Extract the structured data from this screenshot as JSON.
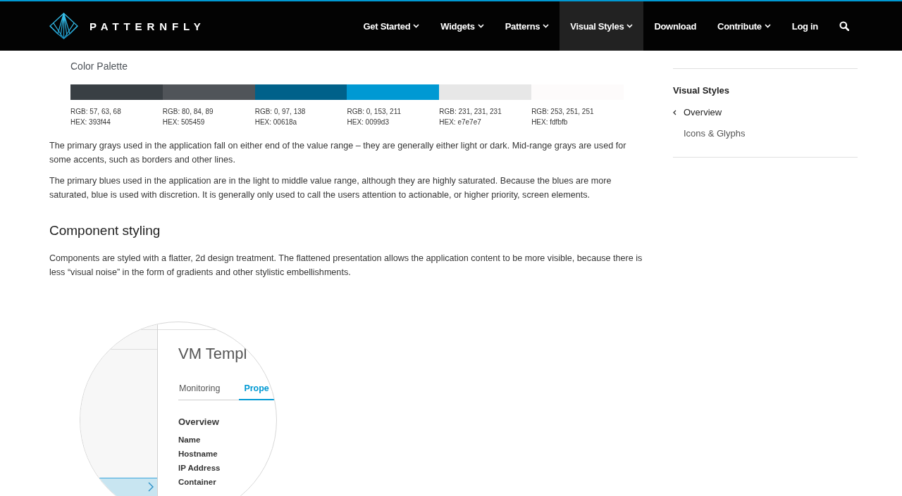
{
  "header": {
    "logo_text": "PATTERNFLY",
    "nav": [
      {
        "label": "Get Started",
        "has_dropdown": true,
        "selected": false
      },
      {
        "label": "Widgets",
        "has_dropdown": true,
        "selected": false
      },
      {
        "label": "Patterns",
        "has_dropdown": true,
        "selected": false
      },
      {
        "label": "Visual Styles",
        "has_dropdown": true,
        "selected": true
      },
      {
        "label": "Download",
        "has_dropdown": false,
        "selected": false
      },
      {
        "label": "Contribute",
        "has_dropdown": true,
        "selected": false
      },
      {
        "label": "Log in",
        "has_dropdown": false,
        "selected": false
      }
    ]
  },
  "content": {
    "palette": {
      "title": "Color Palette",
      "swatches": [
        {
          "color": "#393f44",
          "rgb": "RGB: 57, 63, 68",
          "hex": "HEX: 393f44"
        },
        {
          "color": "#505459",
          "rgb": "RGB: 80, 84, 89",
          "hex": "HEX: 505459"
        },
        {
          "color": "#00618a",
          "rgb": "RGB: 0, 97, 138",
          "hex": "HEX: 00618a"
        },
        {
          "color": "#0099d3",
          "rgb": "RGB: 0, 153, 211",
          "hex": "HEX: 0099d3"
        },
        {
          "color": "#e7e7e7",
          "rgb": "RGB: 231, 231, 231",
          "hex": "HEX: e7e7e7"
        },
        {
          "color": "#fdfbfb",
          "rgb": "RGB: 253, 251, 251",
          "hex": "HEX: fdfbfb"
        }
      ]
    },
    "paragraphs": [
      "The primary grays used in the application fall on either end of the value range – they are generally either light or dark. Mid-range grays are used for some accents, such as borders and other lines.",
      "The primary blues used in the application are in the light to middle value range, although they are highly saturated. Because the blues are more saturated, blue is used with discretion. It is generally only used to call the users attention to actionable, or higher priority, screen elements."
    ],
    "section": {
      "heading": "Component styling",
      "paragraphs": [
        "Components are styled with a flatter, 2d design treatment. The flattened presentation allows the application content to be more visible, because there is less “visual noise” in the form of gradients and other stylistic embellishments."
      ]
    },
    "illustration": {
      "title": "VM Templ",
      "tabs": [
        {
          "label": "Monitoring",
          "selected": false
        },
        {
          "label": "Prope",
          "selected": true
        }
      ],
      "heading": "Overview",
      "fields": [
        "Name",
        "Hostname",
        "IP Address",
        "Container"
      ]
    }
  },
  "sidebar": {
    "title": "Visual Styles",
    "items": [
      {
        "label": "Overview",
        "selected": true
      },
      {
        "label": "Icons & Glyphs",
        "selected": false
      }
    ]
  }
}
